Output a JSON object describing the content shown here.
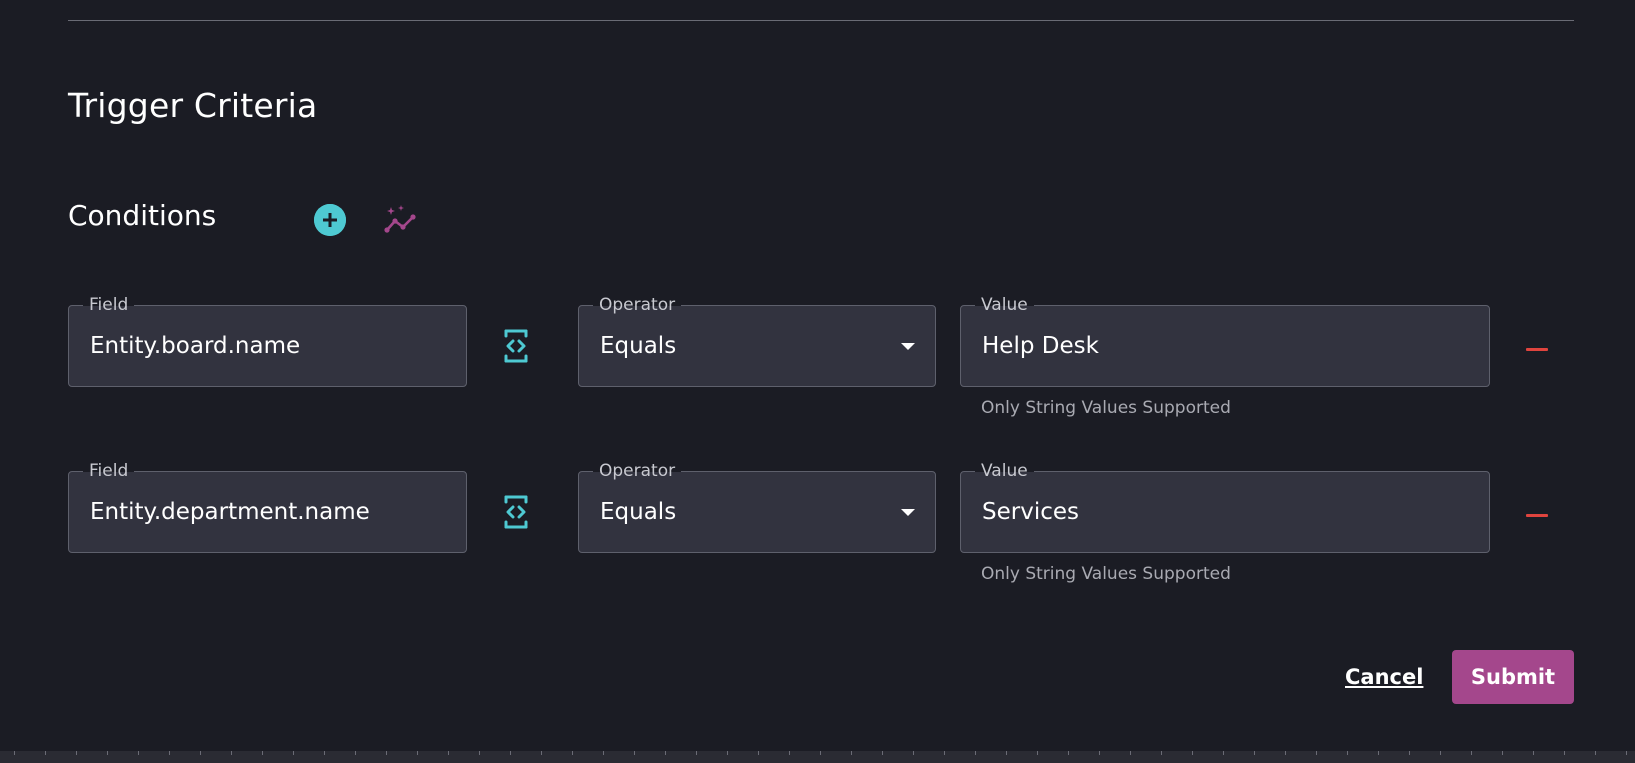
{
  "header": {
    "title": "Trigger Criteria"
  },
  "conditions": {
    "title": "Conditions",
    "add_icon": "plus-circle-icon",
    "ai_icon": "sparkle-chart-icon",
    "rows": [
      {
        "field_label": "Field",
        "field_value": "Entity.board.name",
        "operator_label": "Operator",
        "operator_value": "Equals",
        "value_label": "Value",
        "value_value": "Help Desk",
        "helper": "Only String Values Supported"
      },
      {
        "field_label": "Field",
        "field_value": "Entity.department.name",
        "operator_label": "Operator",
        "operator_value": "Equals",
        "value_label": "Value",
        "value_value": "Services",
        "helper": "Only String Values Supported"
      }
    ]
  },
  "actions": {
    "cancel_label": "Cancel",
    "submit_label": "Submit"
  },
  "colors": {
    "background": "#1b1c24",
    "field_bg": "#32333f",
    "accent_teal": "#4ec9d2",
    "accent_purple": "#a4478c",
    "remove_red": "#e0443e"
  }
}
